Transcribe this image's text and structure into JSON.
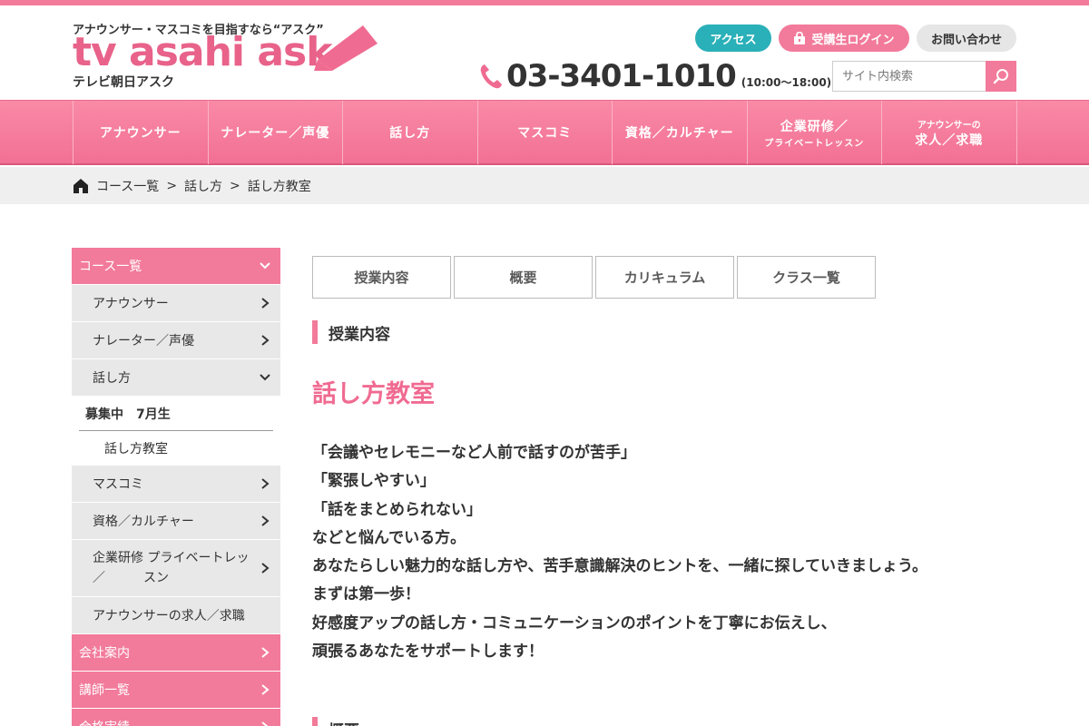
{
  "header": {
    "tagline": "アナウンサー・マスコミを目指すなら“アスク”",
    "wordmark": "tv asahi ask",
    "subname": "テレビ朝日アスク",
    "buttons": {
      "access": "アクセス",
      "login": "受講生ログイン",
      "contact": "お問い合わせ"
    },
    "phone": "03-3401-1010",
    "hours": "(10:00～18:00)",
    "search_placeholder": "サイト内検索"
  },
  "nav": [
    {
      "label": "アナウンサー"
    },
    {
      "label": "ナレーター／声優"
    },
    {
      "label": "話し方"
    },
    {
      "label": "マスコミ"
    },
    {
      "label": "資格／カルチャー"
    },
    {
      "line1": "企業研修／",
      "line2": "プライベートレッスン"
    },
    {
      "line1": "アナウンサーの",
      "line2": "求人／求職"
    }
  ],
  "breadcrumb": [
    "コース一覧",
    "話し方",
    "話し方教室"
  ],
  "breadcrumb_sep": ">",
  "sidebar": {
    "courses_header": "コース一覧",
    "items": [
      {
        "label": "アナウンサー"
      },
      {
        "label": "ナレーター／声優"
      },
      {
        "label": "話し方"
      }
    ],
    "recruit_label": "募集中　7月生",
    "sub_item": "話し方教室",
    "items_after": [
      {
        "label": "マスコミ"
      },
      {
        "label": "資格／カルチャー"
      }
    ],
    "corp_line1": "企業研修 プライベートレッ",
    "corp_line2": "／　　　スン",
    "announcer_jobs": "アナウンサーの求人／求職",
    "company": "会社案内",
    "teachers": "講師一覧",
    "results": "合格実績"
  },
  "tabs": [
    "授業内容",
    "概要",
    "カリキュラム",
    "クラス一覧"
  ],
  "section1_heading": "授業内容",
  "page_title": "話し方教室",
  "body": [
    "「会議やセレモニーなど人前で話すのが苦手」",
    "「緊張しやすい」",
    "「話をまとめられない」",
    "などと悩んでいる方。",
    "あなたらしい魅力的な話し方や、苦手意識解決のヒントを、一緒に探していきましょう。",
    "まずは第一歩！",
    "好感度アップの話し方・コミュニケーションのポイントを丁寧にお伝えし、",
    "頑張るあなたをサポートします！"
  ],
  "section2_heading": "概要",
  "colors": {
    "accent": "#f27a9a",
    "teal": "#2ab0b8",
    "title": "#f06b91"
  }
}
